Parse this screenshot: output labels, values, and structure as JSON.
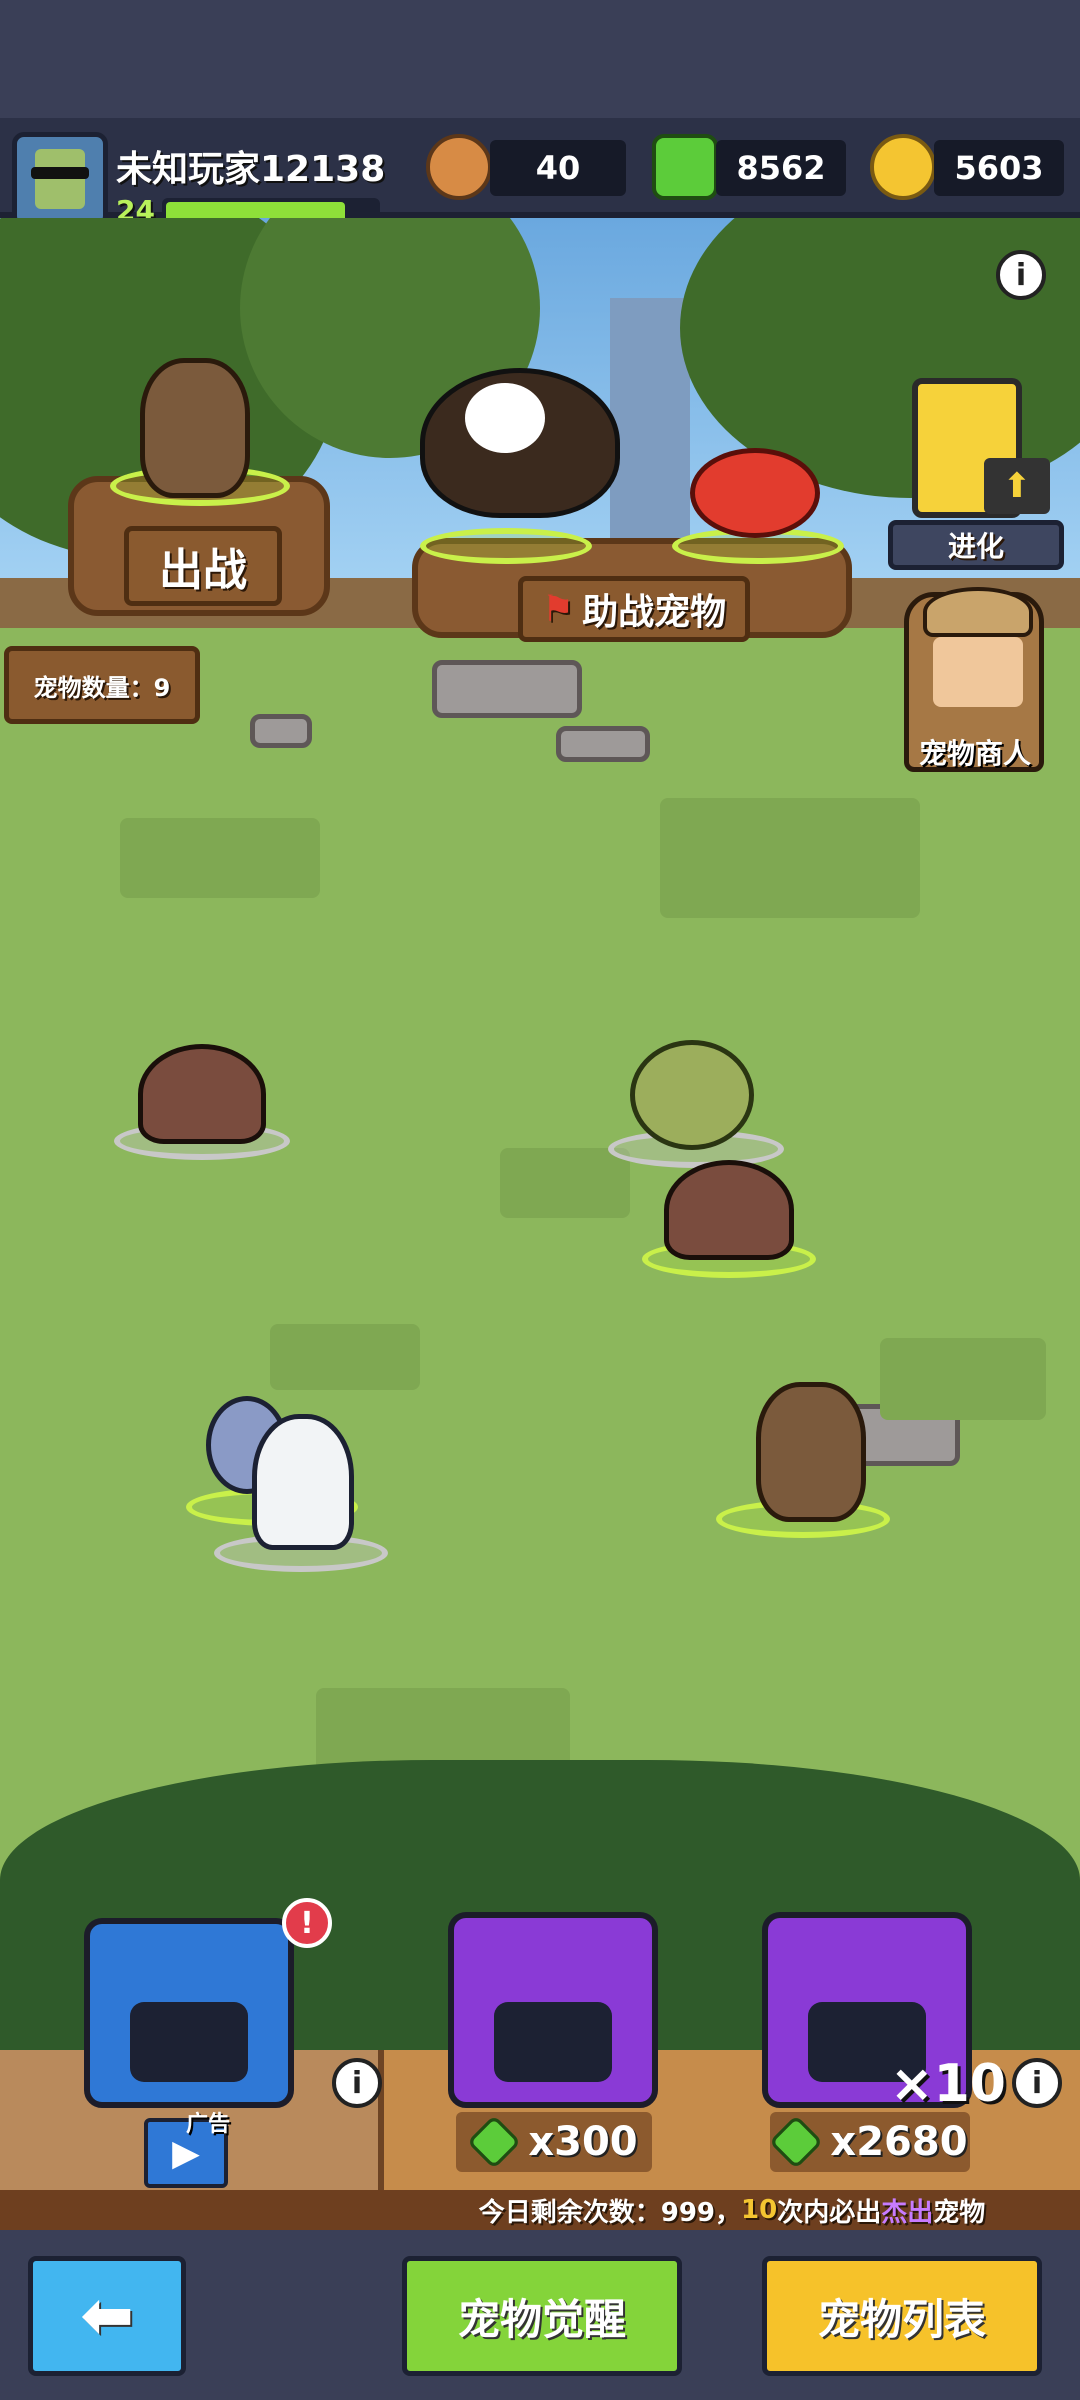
{
  "player": {
    "name": "未知玩家12138",
    "level": "24",
    "xp_fraction": 0.85
  },
  "resources": [
    {
      "name": "paw-token",
      "value": "40",
      "color": "#d78b45"
    },
    {
      "name": "gem",
      "value": "8562",
      "color": "#5ccc3a"
    },
    {
      "name": "gold",
      "value": "5603",
      "color": "#f4c531"
    }
  ],
  "scene": {
    "deploy_label": "出战",
    "assist_label": "助战宠物",
    "evolve_label": "进化",
    "merchant_label": "宠物商人",
    "pet_count_label": "宠物数量：9"
  },
  "chests": [
    {
      "name": "ad-chest",
      "label": "广告",
      "badge": "!"
    },
    {
      "name": "single-chest",
      "price": "x300"
    },
    {
      "name": "ten-chest",
      "multiplier": "×10",
      "price": "x2680"
    }
  ],
  "remaining_text": {
    "prefix": "今日剩余次数：999，",
    "highlight_count": "10",
    "middle": "次内必出",
    "highlight_word": "杰出",
    "suffix": "宠物"
  },
  "buttons": {
    "back": "⬅",
    "awaken": "宠物觉醒",
    "list": "宠物列表"
  },
  "colors": {
    "accent_green": "#8ee039",
    "gold": "#f4c531",
    "purple": "#8a3ad6",
    "blue": "#2f78d6"
  }
}
